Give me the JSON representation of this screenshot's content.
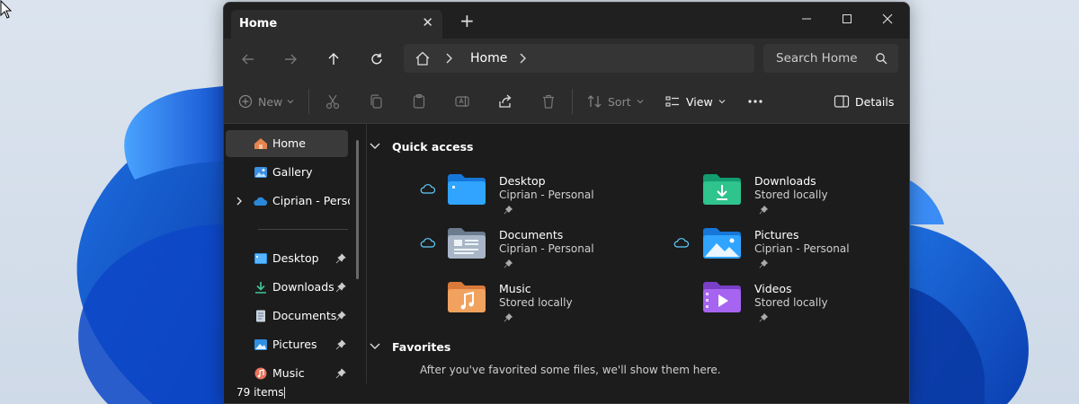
{
  "tab": {
    "title": "Home"
  },
  "address": {
    "location": "Home"
  },
  "search": {
    "placeholder": "Search Home"
  },
  "toolbar": {
    "new_label": "New",
    "sort_label": "Sort",
    "view_label": "View",
    "details_label": "Details"
  },
  "sidebar": {
    "items": [
      {
        "label": "Home"
      },
      {
        "label": "Gallery"
      },
      {
        "label": "Ciprian - Personal"
      }
    ],
    "pinned": [
      {
        "label": "Desktop"
      },
      {
        "label": "Downloads"
      },
      {
        "label": "Documents"
      },
      {
        "label": "Pictures"
      },
      {
        "label": "Music"
      }
    ]
  },
  "quick_access": {
    "title": "Quick access",
    "items": [
      {
        "name": "Desktop",
        "location": "Ciprian - Personal"
      },
      {
        "name": "Downloads",
        "location": "Stored locally"
      },
      {
        "name": "Documents",
        "location": "Ciprian - Personal"
      },
      {
        "name": "Pictures",
        "location": "Ciprian - Personal"
      },
      {
        "name": "Music",
        "location": "Stored locally"
      },
      {
        "name": "Videos",
        "location": "Stored locally"
      }
    ]
  },
  "favorites": {
    "title": "Favorites",
    "empty_message": "After you've favorited some files, we'll show them here."
  },
  "status": {
    "item_count": "79 items"
  },
  "colors": {
    "accent": "#60cdff",
    "window_bg": "#1c1c1c",
    "toolbar_bg": "#2c2c2c"
  }
}
